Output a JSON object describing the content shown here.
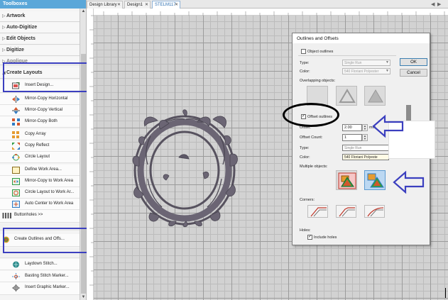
{
  "toolbox": {
    "title": "Toolboxes",
    "sections": [
      {
        "label": "Artwork",
        "caret": "▷"
      },
      {
        "label": "Auto-Digitize",
        "caret": "▷"
      },
      {
        "label": "Edit Objects",
        "caret": "▷"
      },
      {
        "label": "Digitize",
        "caret": "▷"
      },
      {
        "label": "Applique",
        "caret": "▷"
      },
      {
        "label": "Create Layouts",
        "caret": "◢"
      }
    ],
    "tools": [
      {
        "label": "Insert Design...",
        "icon": "insert-design-icon"
      },
      {
        "label": "Mirror-Copy Horizontal",
        "icon": "mirror-horizontal-icon"
      },
      {
        "label": "Mirror-Copy Vertical",
        "icon": "mirror-vertical-icon"
      },
      {
        "label": "Mirror-Copy Both",
        "icon": "mirror-both-icon"
      },
      {
        "label": "Copy Array",
        "icon": "copy-array-icon"
      },
      {
        "label": "Copy Reflect",
        "icon": "copy-reflect-icon"
      },
      {
        "label": "Circle Layout",
        "icon": "circle-layout-icon"
      },
      {
        "label": "Define Work Area...",
        "icon": "define-work-area-icon"
      },
      {
        "label": "Mirror-Copy to Work Area",
        "icon": "mirror-work-area-icon"
      },
      {
        "label": "Circle Layout to Work Ar...",
        "icon": "circle-work-area-icon"
      },
      {
        "label": "Auto Center to Work Area",
        "icon": "auto-center-icon"
      },
      {
        "label": "Buttonholes >>",
        "icon": "buttonholes-icon"
      },
      {
        "label": "Create Outlines and Offs...",
        "icon": "create-outlines-icon"
      },
      {
        "label": "Laydown Stitch...",
        "icon": "laydown-stitch-icon"
      },
      {
        "label": "Basting Stitch Marker...",
        "icon": "basting-marker-icon"
      },
      {
        "label": "Insert Graphic Marker...",
        "icon": "graphic-marker-icon"
      }
    ]
  },
  "tabs": [
    {
      "label": "Design Library",
      "active": false
    },
    {
      "label": "Design1",
      "active": false
    },
    {
      "label": "STELM117",
      "active": true
    }
  ],
  "dialog": {
    "title": "Outlines and Offsets",
    "object_outlines_label": "Object outlines",
    "object_outlines_checked": false,
    "type_label": "Type:",
    "type_value_1": "Single Run",
    "color_label": "Color:",
    "color_value_1": "540 Floriani Polyester",
    "overlapping_label": "Overlapping objects:",
    "offset_outlines_label": "Offset outlines",
    "offset_outlines_checked": true,
    "offset_label": "Offset:",
    "offset_value": "2.00",
    "offset_unit": "mm",
    "offset_count_label": "Offset Count:",
    "offset_count_value": "1",
    "type_value_2": "Single Run",
    "color_value_2": "540 Floriani Polyeste",
    "multiple_label": "Multiple objects:",
    "corners_label": "Corners:",
    "holes_label": "Holes:",
    "include_holes_label": "Include holes",
    "include_holes_checked": true,
    "ok_label": "OK",
    "cancel_label": "Cancel"
  },
  "colors": {
    "accent": "#5aa7d9",
    "annotation_blue": "#3b3fbf",
    "embroidery": "#6b6574",
    "canvas": "#d2d2d2"
  }
}
